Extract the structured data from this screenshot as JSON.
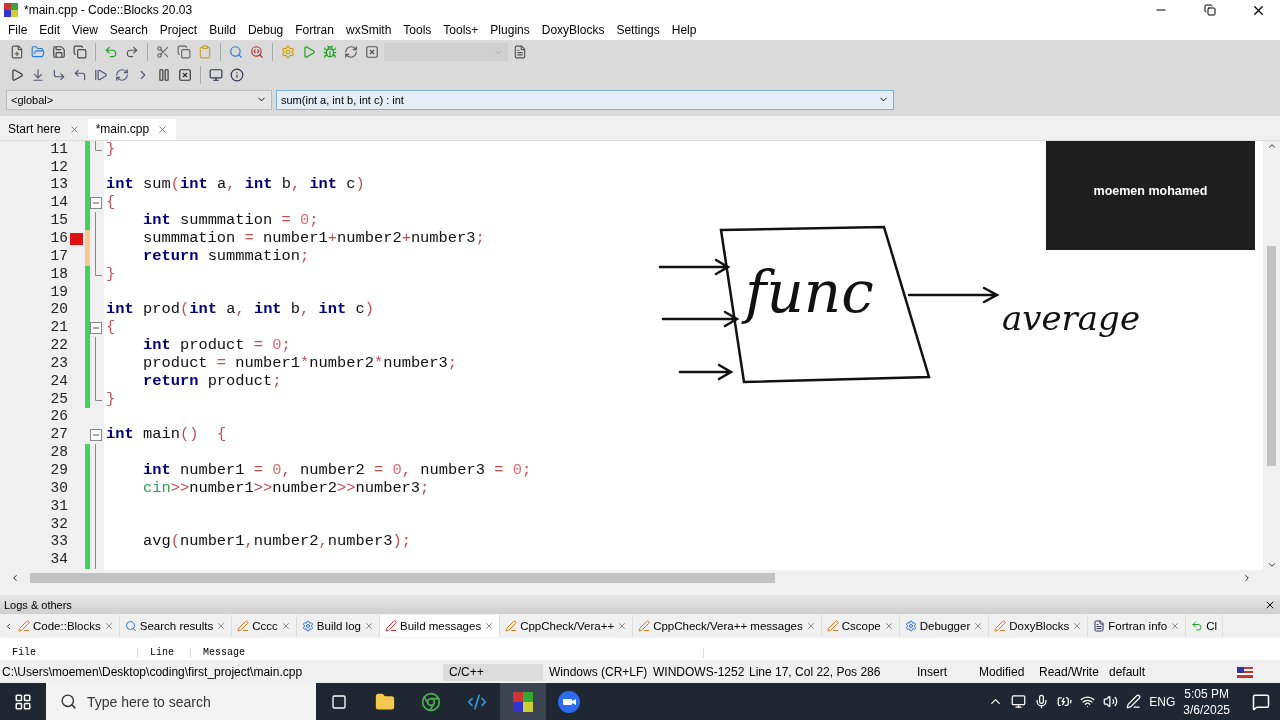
{
  "window": {
    "title": "*main.cpp - Code::Blocks 20.03"
  },
  "menu": [
    "File",
    "Edit",
    "View",
    "Search",
    "Project",
    "Build",
    "Debug",
    "Fortran",
    "wxSmith",
    "Tools",
    "Tools+",
    "Plugins",
    "DoxyBlocks",
    "Settings",
    "Help"
  ],
  "scope_selector": {
    "value": "<global>"
  },
  "function_selector": {
    "value": "sum(int a, int b, int c) : int"
  },
  "editor_tabs": [
    {
      "label": "Start here",
      "selected": false
    },
    {
      "label": "*main.cpp",
      "selected": true
    }
  ],
  "code_lines": [
    {
      "number": "11",
      "changed": true,
      "unsaved": false,
      "breakpoint": false,
      "fold_start": false,
      "fold_end": true,
      "text": "}"
    },
    {
      "number": "12",
      "changed": true,
      "unsaved": false,
      "breakpoint": false,
      "fold_start": false,
      "fold_end": false
    },
    {
      "number": "13",
      "changed": true,
      "unsaved": false,
      "breakpoint": false,
      "fold_start": false,
      "fold_end": false,
      "text": "int sum(int a, int b, int c)"
    },
    {
      "number": "14",
      "changed": true,
      "unsaved": false,
      "breakpoint": false,
      "fold_start": true,
      "fold_end": false,
      "text": "{"
    },
    {
      "number": "15",
      "changed": true,
      "unsaved": false,
      "breakpoint": false,
      "fold_start": false,
      "fold_end": false,
      "text": "    int summmation = 0;"
    },
    {
      "number": "16",
      "changed": true,
      "unsaved": true,
      "breakpoint": true,
      "fold_start": false,
      "fold_end": false,
      "text": "    summmation = number1+number2+number3;"
    },
    {
      "number": "17",
      "changed": true,
      "unsaved": true,
      "breakpoint": false,
      "fold_start": false,
      "fold_end": false,
      "text": "    return summmation;"
    },
    {
      "number": "18",
      "changed": true,
      "unsaved": false,
      "breakpoint": false,
      "fold_start": false,
      "fold_end": true,
      "text": "}"
    },
    {
      "number": "19",
      "changed": true,
      "unsaved": false,
      "breakpoint": false,
      "fold_start": false,
      "fold_end": false
    },
    {
      "number": "20",
      "changed": true,
      "unsaved": false,
      "breakpoint": false,
      "fold_start": false,
      "fold_end": false,
      "text": "int prod(int a, int b, int c)"
    },
    {
      "number": "21",
      "changed": true,
      "unsaved": false,
      "breakpoint": false,
      "fold_start": true,
      "fold_end": false,
      "text": "{"
    },
    {
      "number": "22",
      "changed": true,
      "unsaved": false,
      "breakpoint": false,
      "fold_start": false,
      "fold_end": false,
      "text": "    int product = 0;"
    },
    {
      "number": "23",
      "changed": true,
      "unsaved": false,
      "breakpoint": false,
      "fold_start": false,
      "fold_end": false,
      "text": "    product = number1*number2*number3;"
    },
    {
      "number": "24",
      "changed": true,
      "unsaved": false,
      "breakpoint": false,
      "fold_start": false,
      "fold_end": false,
      "text": "    return product;"
    },
    {
      "number": "25",
      "changed": true,
      "unsaved": false,
      "breakpoint": false,
      "fold_start": false,
      "fold_end": true,
      "text": "}"
    },
    {
      "number": "26",
      "changed": false,
      "breakpoint": false,
      "fold_start": false,
      "fold_end": false
    },
    {
      "number": "27",
      "changed": false,
      "breakpoint": false,
      "fold_start": true,
      "fold_end": false,
      "text": "int main()  {"
    },
    {
      "number": "28",
      "changed": true,
      "unsaved": false,
      "breakpoint": false,
      "fold_start": false,
      "fold_end": false
    },
    {
      "number": "29",
      "changed": true,
      "unsaved": false,
      "breakpoint": false,
      "fold_start": false,
      "fold_end": false,
      "text": "    int number1 = 0, number2 = 0, number3 = 0;"
    },
    {
      "number": "30",
      "changed": true,
      "unsaved": false,
      "breakpoint": false,
      "fold_start": false,
      "fold_end": false,
      "text": "    cin>>number1>>number2>>number3;"
    },
    {
      "number": "31",
      "changed": true,
      "unsaved": false,
      "breakpoint": false,
      "fold_start": false,
      "fold_end": false
    },
    {
      "number": "32",
      "changed": true,
      "unsaved": false,
      "breakpoint": false,
      "fold_start": false,
      "fold_end": false
    },
    {
      "number": "33",
      "changed": true,
      "unsaved": false,
      "breakpoint": false,
      "fold_start": false,
      "fold_end": false,
      "text": "    avg(number1,number2,number3);"
    },
    {
      "number": "34",
      "changed": true,
      "unsaved": false,
      "breakpoint": false,
      "fold_start": false,
      "fold_end": false
    }
  ],
  "whiteboard": {
    "box_label": "func",
    "output_label": "average"
  },
  "participant_tile": {
    "name": "moemen mohamed"
  },
  "logs_panel": {
    "title": "Logs & others",
    "tabs": [
      {
        "label": "Code::Blocks",
        "selected": false
      },
      {
        "label": "Search results",
        "selected": false
      },
      {
        "label": "Cccc",
        "selected": false
      },
      {
        "label": "Build log",
        "selected": false
      },
      {
        "label": "Build messages",
        "selected": true
      },
      {
        "label": "CppCheck/Vera++",
        "selected": false
      },
      {
        "label": "CppCheck/Vera++ messages",
        "selected": false
      },
      {
        "label": "Cscope",
        "selected": false
      },
      {
        "label": "Debugger",
        "selected": false
      },
      {
        "label": "DoxyBlocks",
        "selected": false
      },
      {
        "label": "Fortran info",
        "selected": false
      },
      {
        "label": "Cl",
        "selected": false
      }
    ],
    "columns": [
      "File",
      "Line",
      "Message"
    ]
  },
  "status_bar": [
    "C:\\Users\\moemen\\Desktop\\coding\\first_project\\main.cpp",
    "C/C++",
    "Windows (CR+LF)",
    "WINDOWS-1252",
    "Line 17, Col 22, Pos 286",
    "Insert",
    "Modified",
    "Read/Write",
    "default"
  ],
  "taskbar": {
    "search_placeholder": "Type here to search",
    "language": "ENG",
    "time": "5:05 PM",
    "date": "3/6/2025"
  }
}
